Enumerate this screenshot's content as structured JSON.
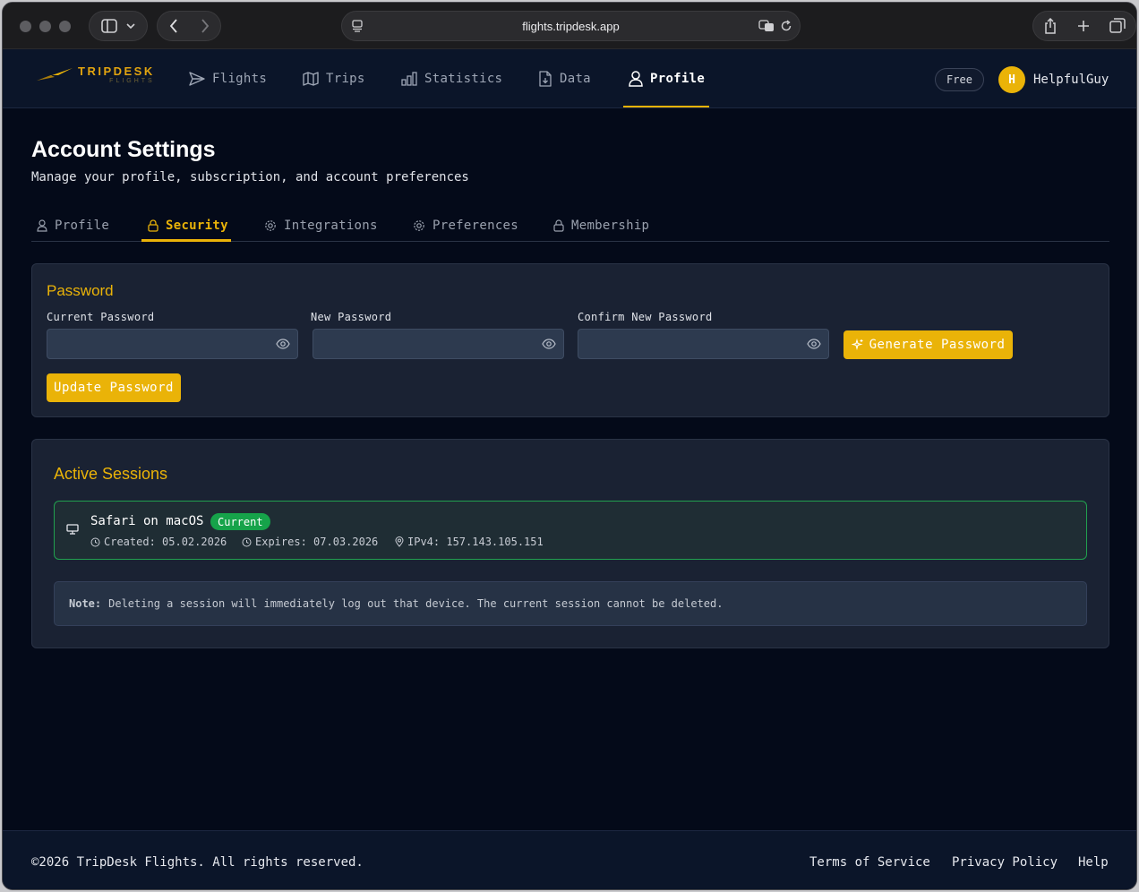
{
  "browser": {
    "url": "flights.tripdesk.app"
  },
  "brand": {
    "name": "TRIPDESK",
    "sub": "FLIGHTS",
    "accent": "#eab308"
  },
  "nav": {
    "items": [
      {
        "label": "Flights",
        "icon": "paper-plane-icon"
      },
      {
        "label": "Trips",
        "icon": "map-icon"
      },
      {
        "label": "Statistics",
        "icon": "bar-chart-icon"
      },
      {
        "label": "Data",
        "icon": "file-download-icon"
      },
      {
        "label": "Profile",
        "icon": "user-icon",
        "active": true
      }
    ],
    "plan_badge": "Free",
    "avatar_initial": "H",
    "username": "HelpfulGuy"
  },
  "header": {
    "title": "Account Settings",
    "subtitle": "Manage your profile, subscription, and account preferences"
  },
  "tabs": [
    {
      "label": "Profile",
      "icon": "user-icon"
    },
    {
      "label": "Security",
      "icon": "lock-icon",
      "active": true
    },
    {
      "label": "Integrations",
      "icon": "gear-icon"
    },
    {
      "label": "Preferences",
      "icon": "gear-icon"
    },
    {
      "label": "Membership",
      "icon": "lock-icon"
    }
  ],
  "password": {
    "title": "Password",
    "current_label": "Current Password",
    "new_label": "New Password",
    "confirm_label": "Confirm New Password",
    "current_value": "",
    "new_value": "",
    "confirm_value": "",
    "generate_label": "Generate Password",
    "update_label": "Update Password"
  },
  "sessions": {
    "title": "Active Sessions",
    "items": [
      {
        "name": "Safari on macOS",
        "badge": "Current",
        "created": "Created: 05.02.2026",
        "expires": "Expires: 07.03.2026",
        "ip": "IPv4: 157.143.105.151"
      }
    ],
    "note_label": "Note:",
    "note_text": "Deleting a session will immediately log out that device. The current session cannot be deleted."
  },
  "footer": {
    "copyright": "©2026 TripDesk Flights. All rights reserved.",
    "links": [
      "Terms of Service",
      "Privacy Policy",
      "Help"
    ]
  }
}
